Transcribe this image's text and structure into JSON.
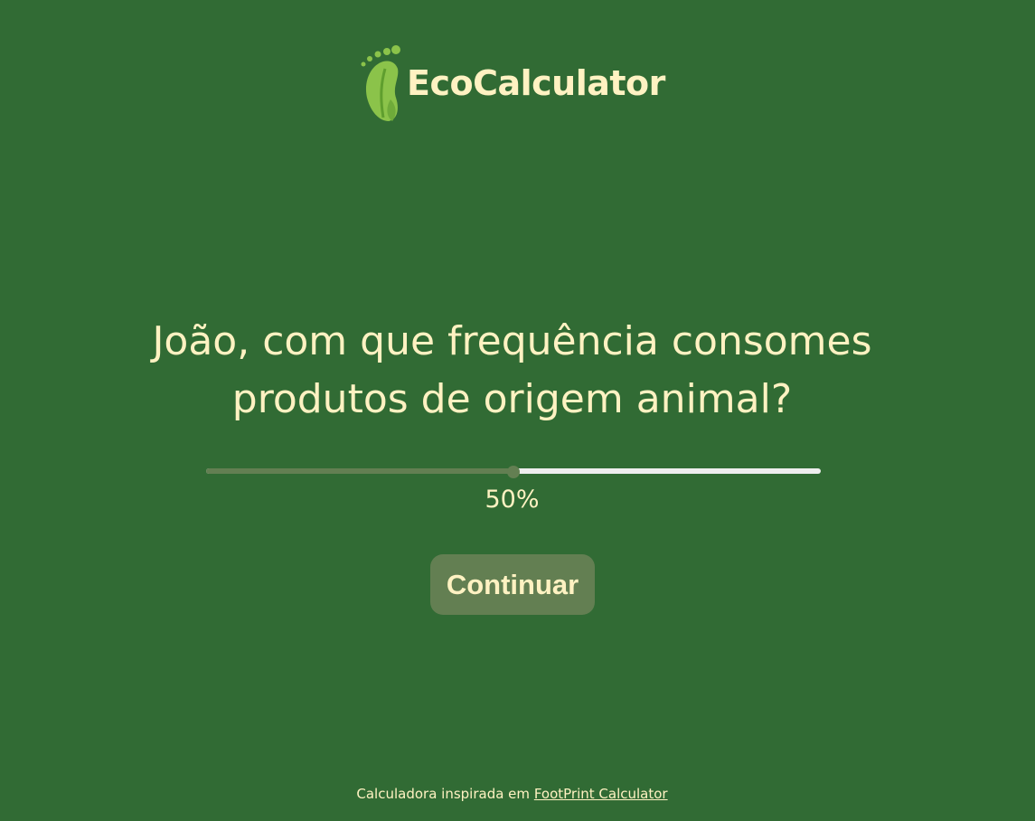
{
  "brand": {
    "name": "EcoCalculator",
    "logo_icon": "footprint-leaf-icon"
  },
  "question": {
    "line1": "João, com que frequência consomes",
    "line2": "produtos de origem animal?"
  },
  "slider": {
    "value": 50,
    "min": 0,
    "max": 100,
    "value_label": "50%"
  },
  "actions": {
    "continue_label": "Continuar"
  },
  "footer": {
    "text": "Calculadora inspirada em",
    "link_label": "FootPrint Calculator"
  },
  "colors": {
    "background": "#316b34",
    "text": "#fff2c2",
    "accent": "#637f52",
    "track": "#eeeeee",
    "logo_green": "#8bc34a"
  }
}
